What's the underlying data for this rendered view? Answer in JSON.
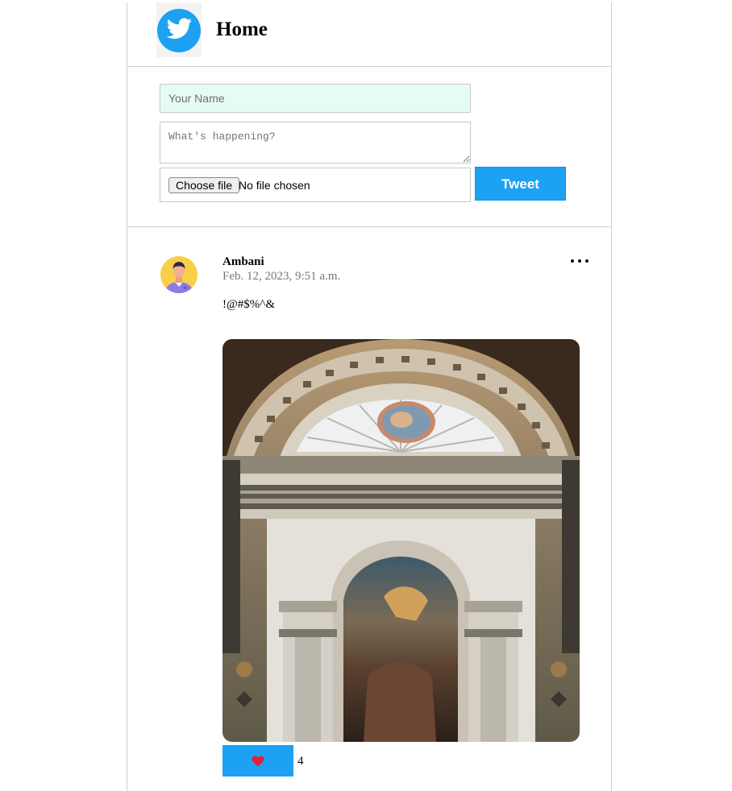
{
  "header": {
    "title": "Home",
    "logo_icon": "twitter-bird-icon",
    "brand_color": "#1da1f2"
  },
  "compose": {
    "name_placeholder": "Your Name",
    "tweet_placeholder": "What's happening?",
    "choose_file_label": "Choose file",
    "file_status": "No file chosen",
    "tweet_button_label": "Tweet"
  },
  "post": {
    "author": "Ambani",
    "timestamp": "Feb. 12, 2023, 9:51 a.m.",
    "text": "!@#$%^&",
    "avatar_icon": "user-avatar-icon",
    "menu_icon": "more-options-icon",
    "image_description_icon": "church-altar-photo",
    "like_icon": "heart-icon",
    "like_count": "4"
  }
}
